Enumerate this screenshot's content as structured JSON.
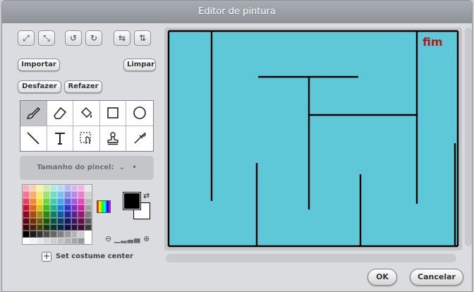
{
  "window": {
    "title": "Editor de pintura"
  },
  "top_icons": [
    "expand-icon",
    "shrink-icon",
    "rotate-ccw-icon",
    "rotate-cw-icon",
    "flip-horizontal-icon",
    "flip-vertical-icon"
  ],
  "buttons": {
    "import": "Importar",
    "clear": "Limpar",
    "undo": "Desfazer",
    "redo": "Refazer",
    "ok": "OK",
    "cancel": "Cancelar"
  },
  "tools": [
    "brush-icon",
    "eraser-icon",
    "fill-bucket-icon",
    "rectangle-icon",
    "ellipse-icon",
    "line-icon",
    "text-icon",
    "select-icon",
    "stamp-icon",
    "eyedropper-icon"
  ],
  "brush_size": {
    "label": "Tamanho do pincel:"
  },
  "colors": {
    "foreground": "#000000",
    "background": "#ffffff",
    "canvas_fill": "#5fc8d8"
  },
  "set_costume_center": "Set costume center",
  "canvas_text": "fim"
}
